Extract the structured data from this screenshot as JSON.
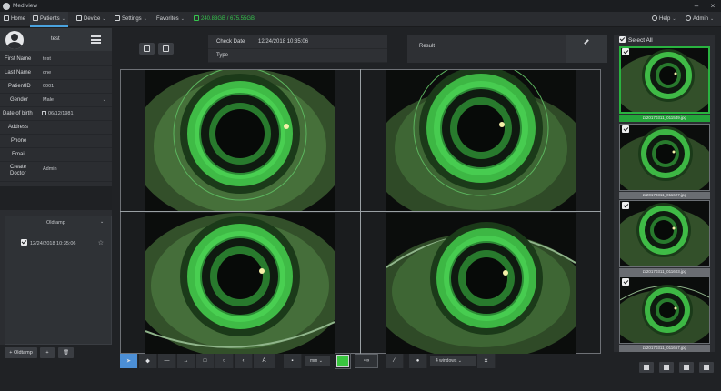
{
  "app": {
    "title": "Mediview"
  },
  "menu": [
    {
      "label": "Home"
    },
    {
      "label": "Patients"
    },
    {
      "label": "Device"
    },
    {
      "label": "Settings"
    },
    {
      "label": "Favorites"
    }
  ],
  "storage": "240.83GB / 675.55GB",
  "header_right": {
    "help": "Help",
    "user": "Admin"
  },
  "patient": {
    "name_header": "test",
    "fields": [
      {
        "label": "First Name",
        "value": "test"
      },
      {
        "label": "Last Name",
        "value": "one"
      },
      {
        "label": "PatientID",
        "value": "0001"
      },
      {
        "label": "Gender",
        "value": "Male"
      },
      {
        "label": "Date of birth",
        "value": "06/12/1981"
      },
      {
        "label": "Address",
        "value": ""
      },
      {
        "label": "Phone",
        "value": ""
      },
      {
        "label": "Email",
        "value": ""
      },
      {
        "label": "Create Doctor",
        "value": "Admin"
      }
    ]
  },
  "checkups": {
    "header": "Oldtamp",
    "items": [
      {
        "date": "12/24/2018 10:35:06"
      }
    ]
  },
  "left_buttons": {
    "add": "+ Oldtamp",
    "plus": "+",
    "delete": "🗑"
  },
  "exam": {
    "check_date_label": "Check Date",
    "check_date_value": "12/24/2018 10:35:06",
    "type_label": "Type",
    "type_value": "",
    "result_label": "Result"
  },
  "toolbar": {
    "unit": "mm",
    "windows": "4 windows",
    "color": "#3ac640"
  },
  "gallery": {
    "select_all": "Select All",
    "thumbs": [
      {
        "caption": "20170311_011549.jpg",
        "active": true
      },
      {
        "caption": "20170311_011627.jpg",
        "active": false
      },
      {
        "caption": "20170311_011603.jpg",
        "active": false
      },
      {
        "caption": "20170311_011657.jpg",
        "active": false
      }
    ]
  }
}
